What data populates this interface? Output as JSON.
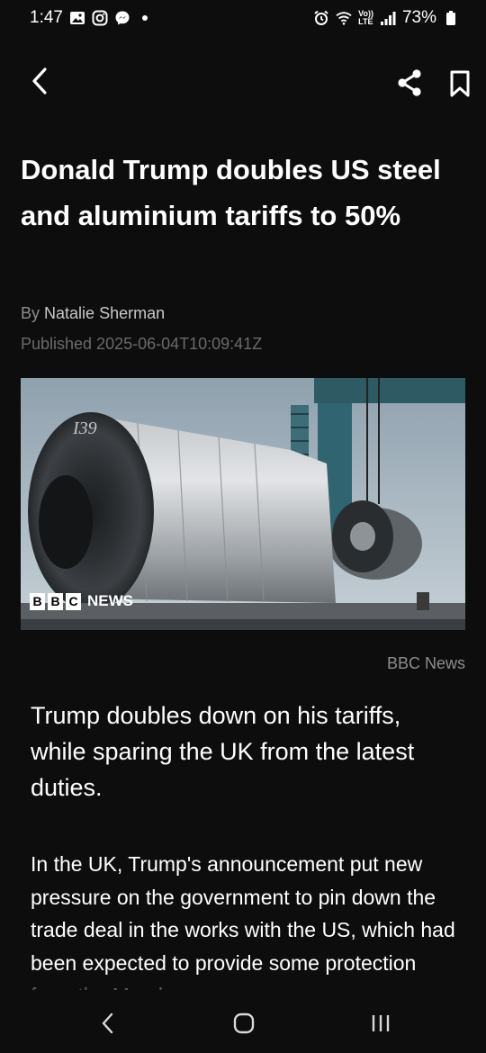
{
  "status_bar": {
    "time": "1:47",
    "battery": "73%",
    "left_icons": [
      "gallery-icon",
      "instagram-icon",
      "messenger-icon"
    ],
    "right_icons": [
      "alarm-icon",
      "wifi-icon",
      "volte-icon",
      "signal-icon",
      "battery-icon"
    ],
    "network_label_top": "Vo))",
    "network_label_bottom": "LTE"
  },
  "app_bar": {
    "icons": [
      "back-arrow-icon",
      "share-icon",
      "bookmark-icon"
    ]
  },
  "article": {
    "title": "Donald Trump doubles US steel and aluminium tariffs to 50%",
    "byline_prefix": "By",
    "author": "Natalie Sherman",
    "published": "Published 2025-06-04T10:09:41Z",
    "image": {
      "coil_marking": "I39",
      "logo_letters": [
        "B",
        "B",
        "C"
      ],
      "logo_word": "NEWS"
    },
    "image_credit": "BBC News",
    "lead": "Trump doubles down on his tariffs, while sparing the UK from the latest duties.",
    "body": "In the UK, Trump's announcement put new pressure on the government to pin down the trade deal in the works with the US, which had been expected to provide some protection from the March"
  },
  "nav_bar": {
    "icons": [
      "nav-back-icon",
      "home-icon",
      "recents-icon"
    ]
  },
  "colors": {
    "background": "#0d0d0d",
    "text": "#ffffff",
    "muted": "#8d8d8d"
  }
}
